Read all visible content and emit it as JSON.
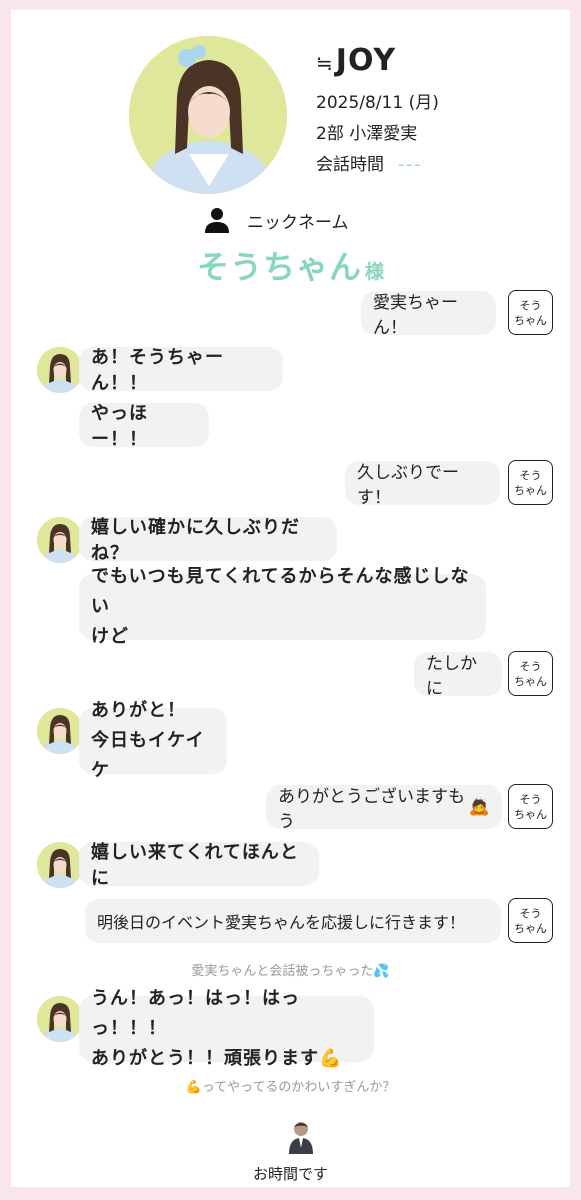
{
  "header": {
    "brand_prefix": "≒",
    "brand": "JOY",
    "date": "2025/8/11 (月)",
    "session_member": "2部  小澤愛実",
    "talk_time_label": "会話時間",
    "talk_time_value": "---"
  },
  "nickname": {
    "label": "ニックネーム",
    "name": "そうちゃん",
    "honorific": "様"
  },
  "fan_badge": {
    "line1": "そう",
    "line2": "ちゃん"
  },
  "messages": [
    {
      "from": "fan",
      "text": "愛実ちゃーん！"
    },
    {
      "from": "idol",
      "text": "あ！そうちゃーん！！"
    },
    {
      "from": "idol",
      "text": "やっほー！！"
    },
    {
      "from": "fan",
      "text": "久しぶりでーす！"
    },
    {
      "from": "idol",
      "text": "嬉しい確かに久しぶりだね？"
    },
    {
      "from": "idol",
      "line1": "でもいつも見てくれてるからそんな感じしない",
      "line2": "けど"
    },
    {
      "from": "fan",
      "text": "たしかに"
    },
    {
      "from": "idol",
      "line1": "ありがと！",
      "line2": "今日もイケイケ"
    },
    {
      "from": "fan",
      "text": "ありがとうございますもう",
      "emoji": "🙇"
    },
    {
      "from": "idol",
      "text": "嬉しい来てくれてほんとに"
    },
    {
      "from": "fan",
      "text": "明後日のイベント愛実ちゃんを応援しに行きます！"
    },
    {
      "from": "note",
      "text": "愛実ちゃんと会話被っちゃった",
      "emoji": "💦"
    },
    {
      "from": "idol",
      "line1": "うん！あっ！はっ！はっっ！！！",
      "line2": "ありがとう！！頑張ります",
      "emoji": "💪"
    },
    {
      "from": "note",
      "emoji": "💪",
      "text": "ってやってるのかわいすぎんか？"
    }
  ],
  "footer": {
    "end_text": "お時間です",
    "icon": "person-in-suit-icon"
  },
  "colors": {
    "accent": "#88d6bd",
    "page_bg": "#f8e6ec",
    "bubble": "#f2f2f2",
    "avatar_bg": "#dfe79a"
  }
}
